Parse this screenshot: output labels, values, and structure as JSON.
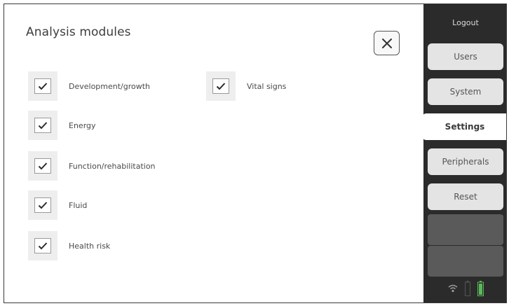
{
  "page": {
    "title": "Analysis modules"
  },
  "close": {
    "icon": "close-icon"
  },
  "modules": [
    {
      "label": "Development/growth",
      "checked": true
    },
    {
      "label": "Vital signs",
      "checked": true
    },
    {
      "label": "Energy",
      "checked": true
    },
    {
      "label": "Function/rehabilitation",
      "checked": true
    },
    {
      "label": "Fluid",
      "checked": true
    },
    {
      "label": "Health risk",
      "checked": true
    }
  ],
  "sidebar": {
    "logout": "Logout",
    "tabs": [
      {
        "label": "Users",
        "active": false
      },
      {
        "label": "System",
        "active": false
      },
      {
        "label": "Settings",
        "active": true
      },
      {
        "label": "Peripherals",
        "active": false
      },
      {
        "label": "Reset",
        "active": false
      }
    ],
    "status_icons": [
      "wifi-icon",
      "battery-empty-icon",
      "battery-full-icon"
    ]
  },
  "colors": {
    "sidebar_bg": "#2b2b2b",
    "tab_bg": "#e4e4e4",
    "check_accent": "#2a2a2a",
    "battery_green": "#5cb85c"
  }
}
